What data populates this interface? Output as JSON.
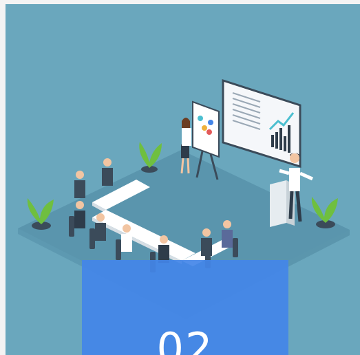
{
  "card": {
    "step_number": "02",
    "background_color": "#6aa7bd",
    "accent_color": "#4385e8",
    "illustration_name": "meeting-room-illustration"
  }
}
